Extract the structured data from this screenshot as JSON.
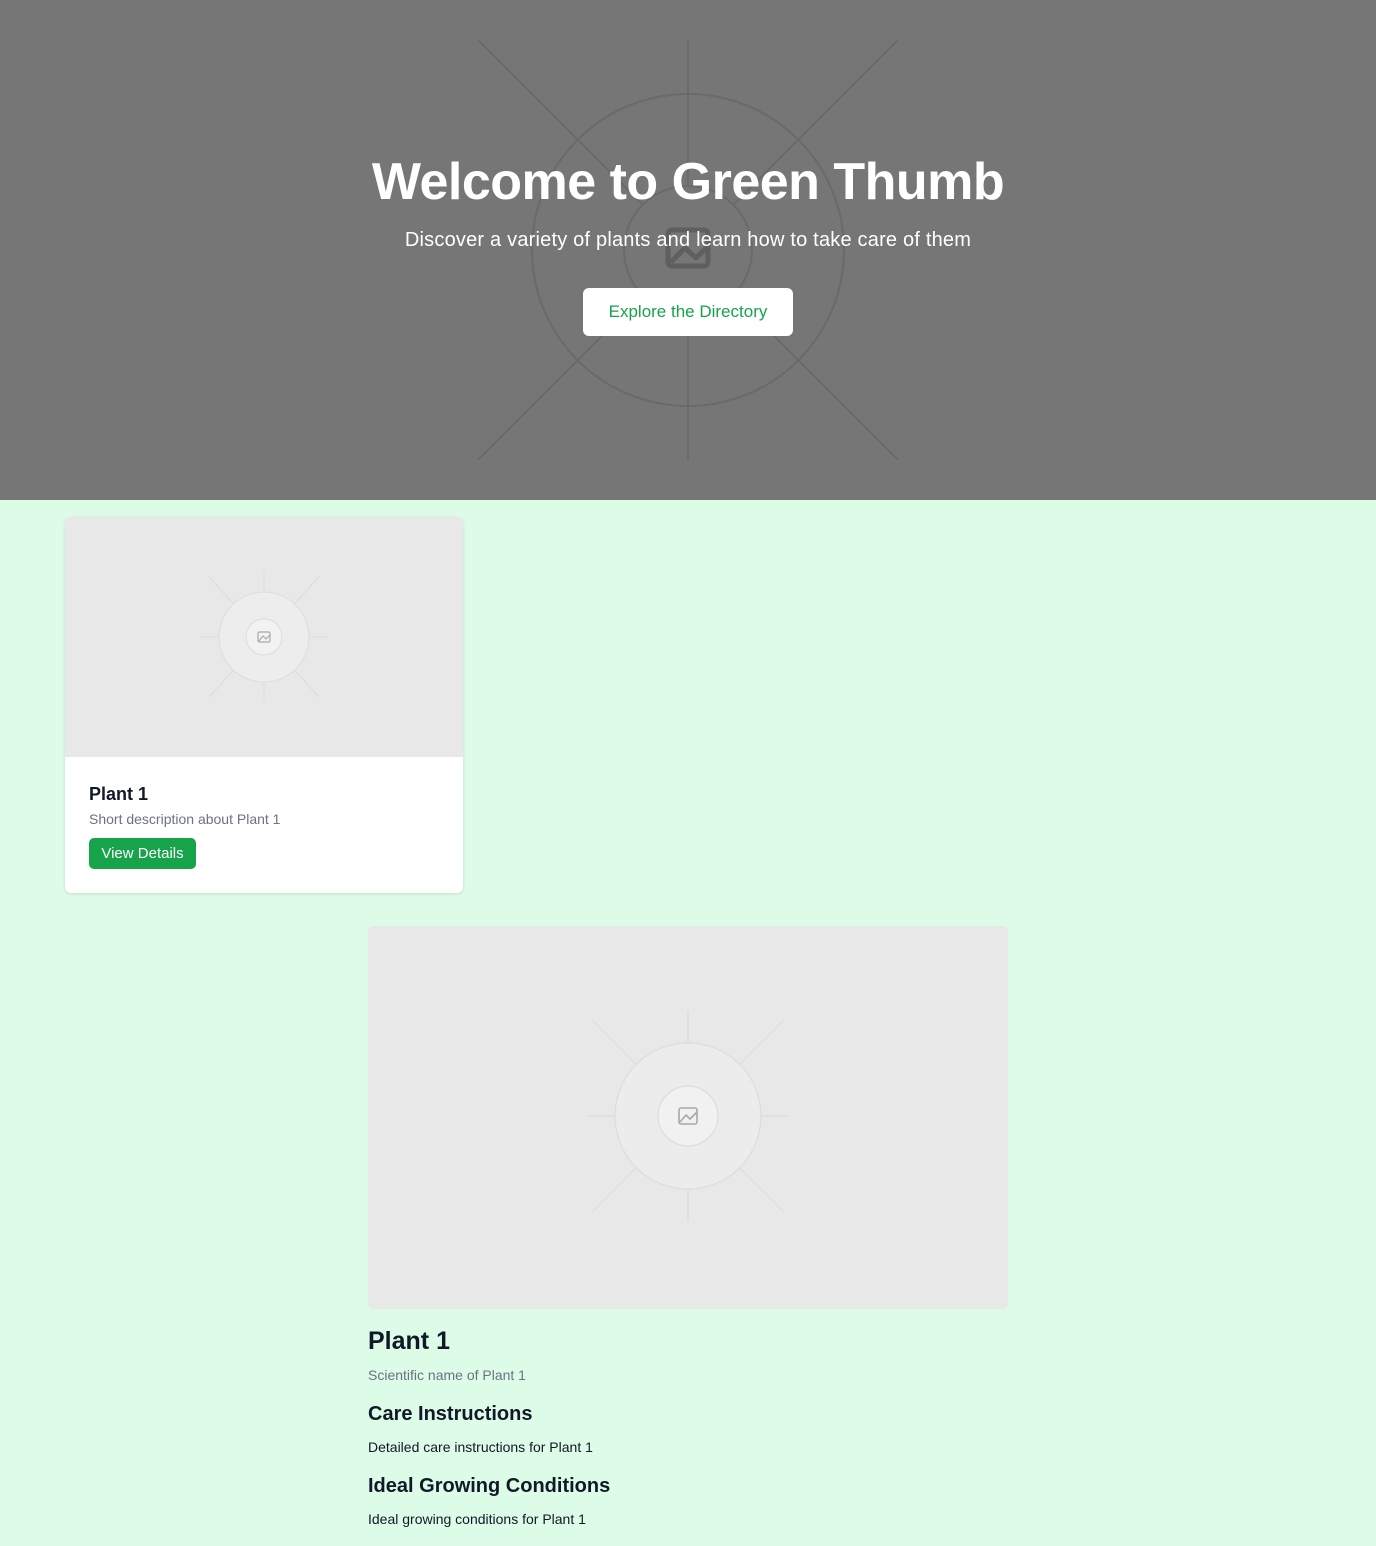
{
  "hero": {
    "title": "Welcome to Green Thumb",
    "subtitle": "Discover a variety of plants and learn how to take care of them",
    "cta_label": "Explore the Directory",
    "image_icon": "image-placeholder-icon"
  },
  "plant_card": {
    "name": "Plant 1",
    "description": "Short description about Plant 1",
    "button_label": "View Details",
    "image_icon": "image-placeholder-icon"
  },
  "plant_detail": {
    "name": "Plant 1",
    "scientific_name": "Scientific name of Plant 1",
    "care_heading": "Care Instructions",
    "care_text": "Detailed care instructions for Plant 1",
    "conditions_heading": "Ideal Growing Conditions",
    "conditions_text": "Ideal growing conditions for Plant 1",
    "image_icon": "image-placeholder-icon"
  },
  "colors": {
    "page_background": "#dcfce7",
    "hero_background": "#767676",
    "accent": "#16a34a",
    "muted_text": "#6b7280",
    "placeholder": "#e8e8e8"
  }
}
